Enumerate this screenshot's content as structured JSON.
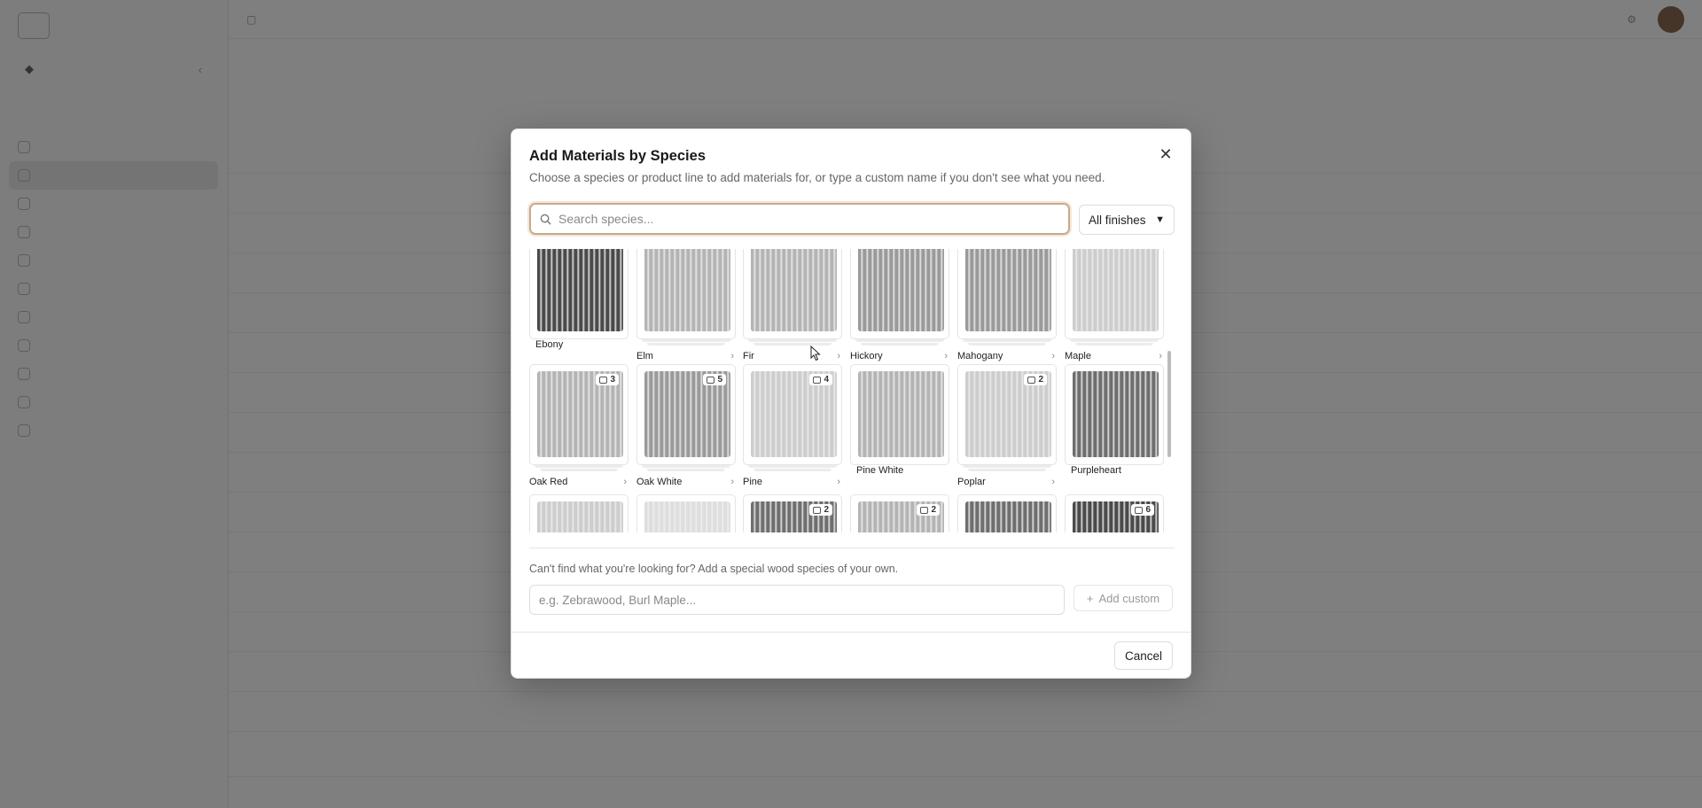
{
  "modal": {
    "title": "Add Materials by Species",
    "subtitle": "Choose a species or product line to add materials for, or type a custom name if you don't see what you need.",
    "search_placeholder": "Search species...",
    "finish_filter": "All finishes",
    "custom_hint": "Can't find what you're looking for? Add a special wood species of your own.",
    "custom_placeholder": "e.g. Zebrawood, Burl Maple...",
    "add_custom_label": "Add custom",
    "cancel_label": "Cancel"
  },
  "species": [
    {
      "name": "Ebony",
      "badge": null,
      "has_chevron": false,
      "stacked": false,
      "tone": "dark"
    },
    {
      "name": "Elm",
      "badge": null,
      "has_chevron": true,
      "stacked": true,
      "tone": "light"
    },
    {
      "name": "Fir",
      "badge": null,
      "has_chevron": true,
      "stacked": true,
      "tone": "light"
    },
    {
      "name": "Hickory",
      "badge": null,
      "has_chevron": true,
      "stacked": true,
      "tone": "mid"
    },
    {
      "name": "Mahogany",
      "badge": null,
      "has_chevron": true,
      "stacked": true,
      "tone": "mid"
    },
    {
      "name": "Maple",
      "badge": null,
      "has_chevron": true,
      "stacked": true,
      "tone": "pale"
    },
    {
      "name": "Oak Red",
      "badge": "3",
      "has_chevron": true,
      "stacked": true,
      "tone": "light"
    },
    {
      "name": "Oak White",
      "badge": "5",
      "has_chevron": true,
      "stacked": true,
      "tone": "mid"
    },
    {
      "name": "Pine",
      "badge": "4",
      "has_chevron": true,
      "stacked": true,
      "tone": "pale"
    },
    {
      "name": "Pine White",
      "badge": null,
      "has_chevron": false,
      "stacked": false,
      "tone": "light"
    },
    {
      "name": "Poplar",
      "badge": "2",
      "has_chevron": true,
      "stacked": true,
      "tone": "pale"
    },
    {
      "name": "Purpleheart",
      "badge": null,
      "has_chevron": false,
      "stacked": false,
      "tone": "darkmid"
    },
    {
      "name": "",
      "badge": null,
      "has_chevron": false,
      "stacked": false,
      "tone": "pale"
    },
    {
      "name": "",
      "badge": null,
      "has_chevron": false,
      "stacked": false,
      "tone": "white"
    },
    {
      "name": "",
      "badge": "2",
      "has_chevron": false,
      "stacked": false,
      "tone": "darkmid"
    },
    {
      "name": "",
      "badge": "2",
      "has_chevron": false,
      "stacked": false,
      "tone": "light"
    },
    {
      "name": "",
      "badge": null,
      "has_chevron": false,
      "stacked": false,
      "tone": "darkmid"
    },
    {
      "name": "",
      "badge": "6",
      "has_chevron": false,
      "stacked": false,
      "tone": "dark"
    }
  ],
  "tone_colors": {
    "dark": "#4a4a4a",
    "darkmid": "#6e6e6e",
    "mid": "#9a9a9a",
    "light": "#b4b4b4",
    "pale": "#cdcdcd",
    "white": "#dedede"
  }
}
